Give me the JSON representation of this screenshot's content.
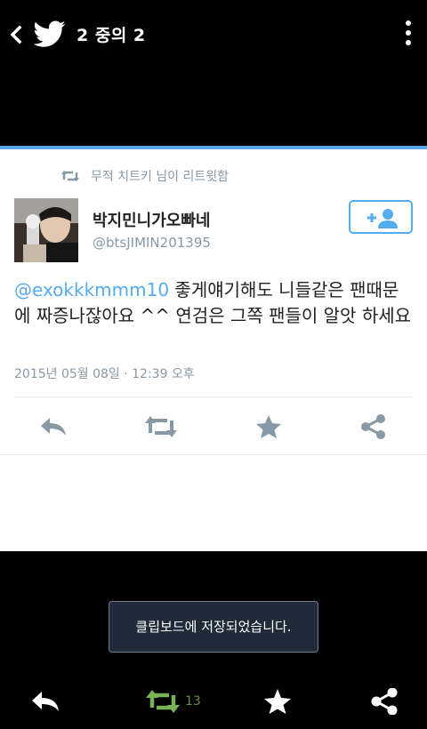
{
  "topbar": {
    "pager_label": "2 중의 2",
    "back_icon": "back-chevron-icon",
    "logo_icon": "twitter-bird-icon",
    "menu_icon": "overflow-menu-icon"
  },
  "tweet": {
    "retweeted_by": "무적 치트키 님이 리트윗함",
    "display_name": "박지민니가오빠네",
    "handle": "@btsJIMIN201395",
    "mention": "@exokkkmmm10",
    "body": " 좋게얘기해도 니들같은 팬때문에 짜증나잖아요 ^^  연검은 그쪽 팬들이 알앗 하세요",
    "timestamp": "2015년 05월 08일 · 12:39 오후"
  },
  "colors": {
    "accent": "#55acee",
    "card_top_line": "#5aa7e6",
    "retweet_active": "#77b255",
    "muted_text": "#8899a6"
  },
  "toast": {
    "message": "클립보드에 저장되었습니다."
  },
  "bottombar": {
    "retweet_count": "13"
  }
}
